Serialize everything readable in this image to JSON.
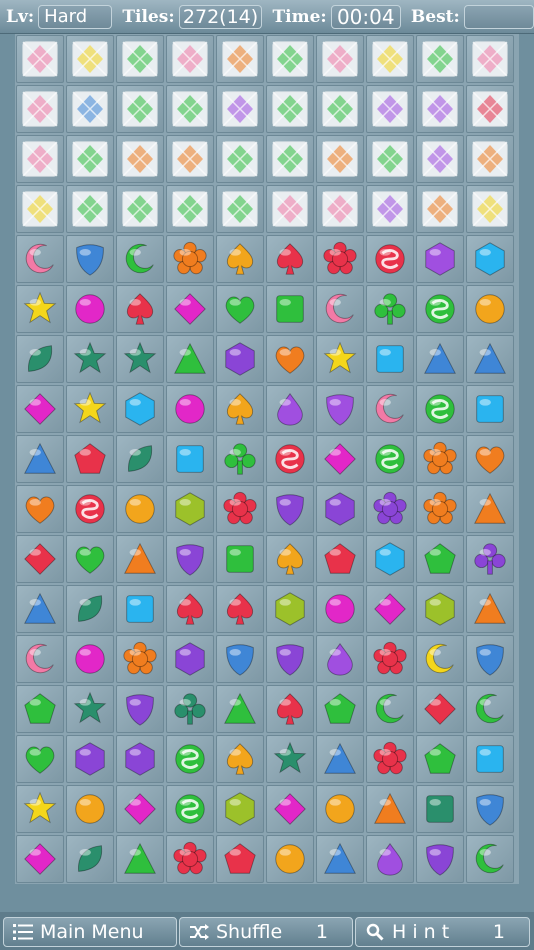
{
  "header": {
    "level_label": "Lv:",
    "level_value": "Hard",
    "tiles_label": "Tiles:",
    "tiles_value": "272(14)",
    "time_label": "Time:",
    "time_value": "00:04",
    "best_label": "Best:",
    "best_value": ""
  },
  "colors": {
    "pink": "#f27aa6",
    "blue": "#3f86d6",
    "green": "#2fbf3d",
    "orange": "#f07d1f",
    "amber": "#f2a51c",
    "red": "#e8324a",
    "purple": "#a04fe0",
    "cyan": "#2ab4ef",
    "yellow": "#f4d61b",
    "magenta": "#e227c8",
    "teal": "#2a8f6c",
    "violet": "#8a45d6"
  },
  "board": {
    "rows": [
      [
        "pack-pink",
        "pack-yellow",
        "pack-green",
        "pack-pink",
        "pack-orange",
        "pack-green",
        "pack-pink",
        "pack-yellow",
        "pack-green",
        "pack-pink"
      ],
      [
        "pack-pink",
        "pack-blue",
        "pack-green",
        "pack-green",
        "pack-purple",
        "pack-green",
        "pack-green",
        "pack-purple",
        "pack-purple",
        "pack-red"
      ],
      [
        "pack-pink",
        "pack-green",
        "pack-orange",
        "pack-orange",
        "pack-green",
        "pack-green",
        "pack-orange",
        "pack-green",
        "pack-purple",
        "pack-orange"
      ],
      [
        "pack-yellow",
        "pack-green",
        "pack-green",
        "pack-green",
        "pack-green",
        "pack-pink",
        "pack-pink",
        "pack-purple",
        "pack-orange",
        "pack-yellow"
      ],
      [
        "pink-moon",
        "blue-shield",
        "green-moon",
        "orange-flower",
        "amber-spade",
        "red-spade",
        "red-flower",
        "red-swirl",
        "purple-hexagon",
        "cyan-hexagon"
      ],
      [
        "yellow-star",
        "magenta-circle",
        "red-spade",
        "magenta-diamond",
        "green-heart",
        "green-square",
        "pink-moon",
        "green-club",
        "green-swirl",
        "amber-circle"
      ],
      [
        "teal-leaf",
        "teal-star",
        "teal-star",
        "green-triangle",
        "violet-hexagon",
        "orange-heart",
        "yellow-star",
        "cyan-square",
        "blue-triangle",
        "blue-triangle"
      ],
      [
        "magenta-diamond",
        "yellow-star",
        "cyan-hexagon",
        "magenta-circle",
        "amber-spade",
        "purple-drop",
        "purple-shield",
        "pink-moon",
        "green-swirl",
        "cyan-square"
      ],
      [
        "blue-triangle",
        "red-pentagon",
        "teal-leaf",
        "cyan-square",
        "green-club",
        "red-swirl",
        "magenta-diamond",
        "green-swirl",
        "orange-flower",
        "orange-heart"
      ],
      [
        "orange-heart",
        "red-swirl",
        "amber-circle",
        "olive-hexagon",
        "red-flower",
        "violet-shield",
        "violet-hexagon",
        "violet-flower",
        "orange-flower",
        "orange-triangle"
      ],
      [
        "red-diamond",
        "green-heart",
        "orange-triangle",
        "violet-shield",
        "green-square",
        "amber-spade",
        "red-pentagon",
        "cyan-hexagon",
        "green-pentagon",
        "violet-club"
      ],
      [
        "blue-triangle",
        "teal-leaf",
        "cyan-square",
        "red-spade",
        "red-spade",
        "olive-hexagon",
        "magenta-circle",
        "magenta-diamond",
        "olive-hexagon",
        "orange-triangle"
      ],
      [
        "pink-moon",
        "magenta-circle",
        "orange-flower",
        "violet-hexagon",
        "blue-shield",
        "violet-shield",
        "purple-drop",
        "red-flower",
        "yellow-moon",
        "blue-shield"
      ],
      [
        "green-pentagon",
        "teal-star",
        "violet-shield",
        "teal-club",
        "green-triangle",
        "red-spade",
        "green-pentagon",
        "green-moon",
        "red-diamond",
        "green-moon"
      ],
      [
        "green-heart",
        "violet-hexagon",
        "violet-hexagon",
        "green-swirl",
        "amber-spade",
        "teal-star",
        "blue-triangle",
        "red-flower",
        "green-pentagon",
        "cyan-square"
      ],
      [
        "yellow-star",
        "amber-circle",
        "magenta-diamond",
        "green-swirl",
        "olive-hexagon",
        "magenta-diamond",
        "amber-circle",
        "orange-triangle",
        "teal-square",
        "blue-shield"
      ],
      [
        "magenta-diamond",
        "teal-leaf",
        "green-triangle",
        "red-flower",
        "red-pentagon",
        "amber-circle",
        "blue-triangle",
        "purple-drop",
        "violet-shield",
        "green-moon"
      ]
    ]
  },
  "toolbar": {
    "menu_label": "Main Menu",
    "menu_icon": "list-icon",
    "shuffle_label": "Shuffle",
    "shuffle_icon": "shuffle-icon",
    "shuffle_count": "1",
    "hint_label": "H i n t",
    "hint_icon": "search-icon",
    "hint_count": "1"
  }
}
